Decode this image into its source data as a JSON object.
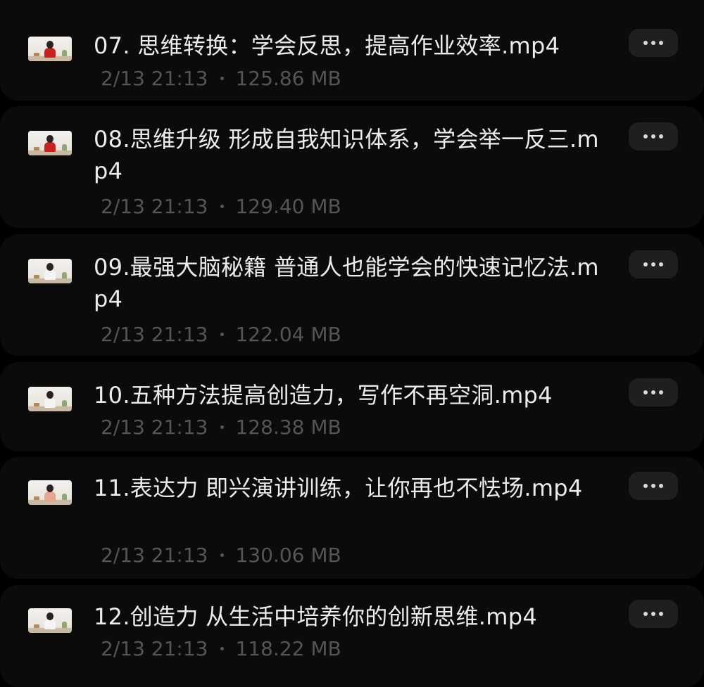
{
  "files": [
    {
      "name": "07. 思维转换：学会反思，提高作业效率.mp4",
      "date": "2/13 21:13",
      "size": "125.86 MB",
      "thumbnail_icon": "video-thumbnail-icon",
      "shirt_color": "#c8221f"
    },
    {
      "name": "08.思维升级 形成自我知识体系，学会举一反三.mp4",
      "date": "2/13 21:13",
      "size": "129.40 MB",
      "thumbnail_icon": "video-thumbnail-icon",
      "shirt_color": "#c8221f"
    },
    {
      "name": "09.最强大脑秘籍 普通人也能学会的快速记忆法.mp4",
      "date": "2/13 21:13",
      "size": "122.04 MB",
      "thumbnail_icon": "video-thumbnail-icon",
      "shirt_color": "#f4f4f4"
    },
    {
      "name": "10.五种方法提高创造力，写作不再空洞.mp4",
      "date": "2/13 21:13",
      "size": "128.38 MB",
      "thumbnail_icon": "video-thumbnail-icon",
      "shirt_color": "#f4f4f4"
    },
    {
      "name": "11.表达力 即兴演讲训练，让你再也不怯场.mp4",
      "date": "2/13 21:13",
      "size": "130.06 MB",
      "thumbnail_icon": "video-thumbnail-icon",
      "shirt_color": "#e9a58f"
    },
    {
      "name": "12.创造力 从生活中培养你的创新思维.mp4",
      "date": "2/13 21:13",
      "size": "118.22 MB",
      "thumbnail_icon": "video-thumbnail-icon",
      "shirt_color": "#f4f4f4"
    }
  ],
  "more_icon": "more-horizontal-icon",
  "colors": {
    "background": "#000000",
    "card": "#0b0b0c",
    "title_text": "#ececec",
    "meta_text": "#555557",
    "more_button": "#1f1f21"
  }
}
